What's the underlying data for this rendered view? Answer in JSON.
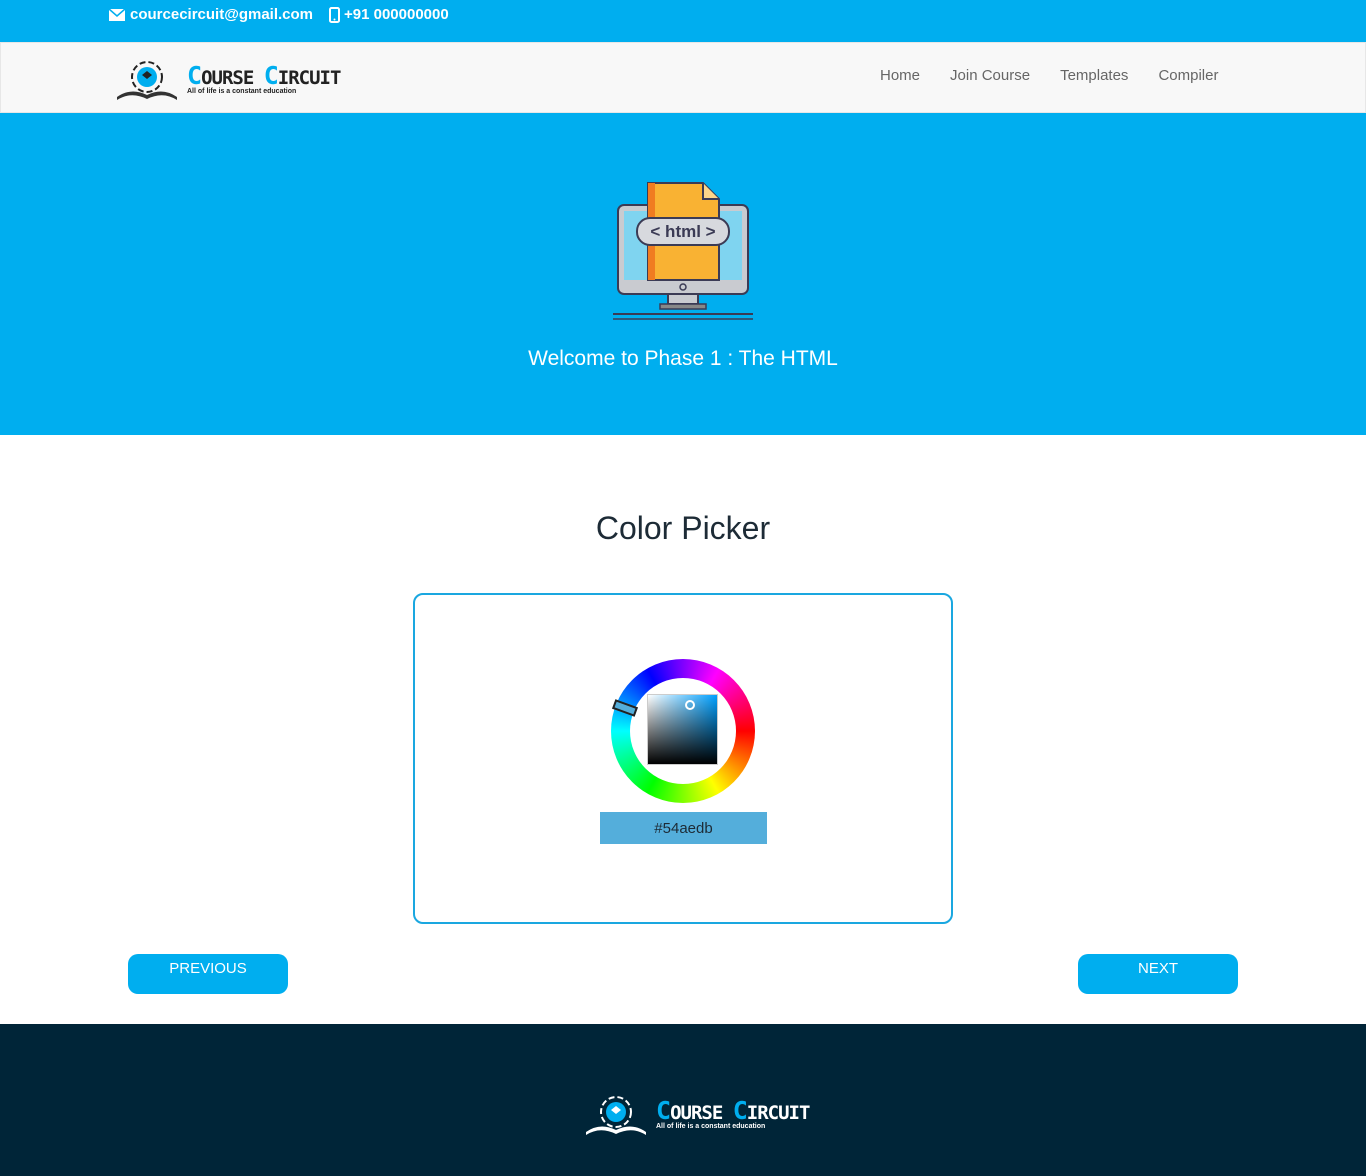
{
  "topbar": {
    "email": "courcecircuit@gmail.com",
    "phone": "+91 000000000"
  },
  "brand": {
    "name_prefix_1": "C",
    "name_rest_1": "OURSE ",
    "name_prefix_2": "C",
    "name_rest_2": "IRCUIT",
    "tagline": "All of life is a constant education"
  },
  "nav": {
    "items": [
      "Home",
      "Join Course",
      "Templates",
      "Compiler"
    ]
  },
  "hero": {
    "badge_text": "< html >",
    "title": "Welcome to Phase 1 : The HTML"
  },
  "main": {
    "title": "Color Picker",
    "hex_value": "#54aedb"
  },
  "buttons": {
    "previous": "PREVIOUS",
    "next": "NEXT"
  },
  "colors": {
    "accent": "#00aeef",
    "picked": "#54aedb",
    "footer": "#002538"
  },
  "icons": [
    "envelope-icon",
    "mobile-phone-icon",
    "book-logo-icon",
    "html-monitor-illustration"
  ]
}
